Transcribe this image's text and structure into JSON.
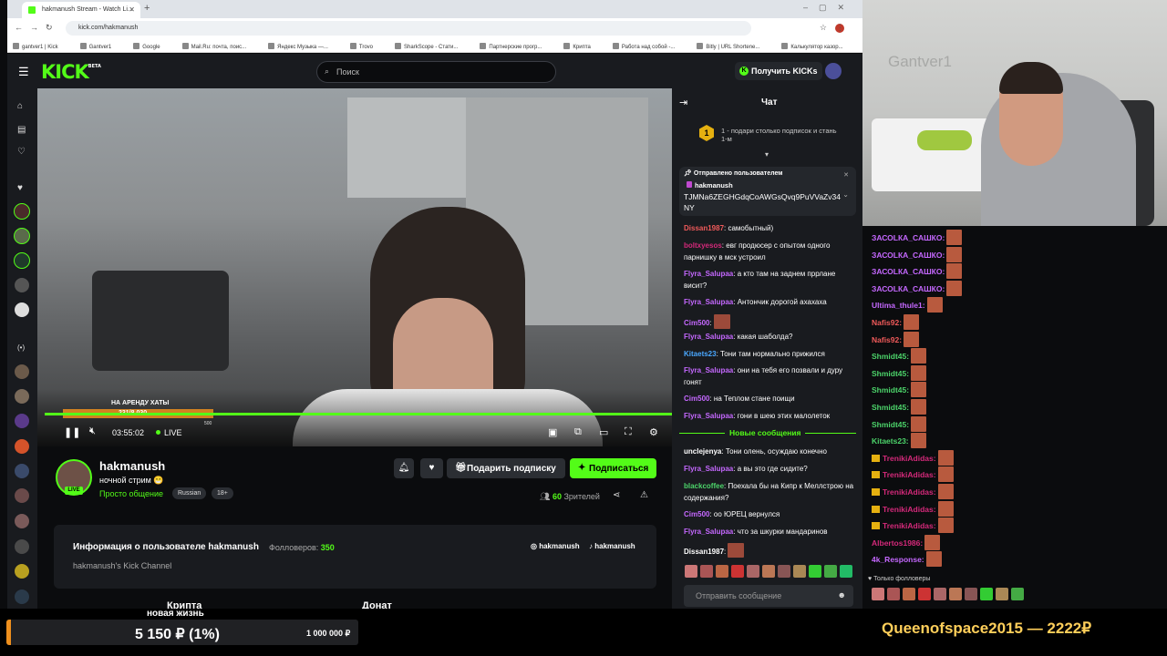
{
  "browser": {
    "tab_title": "hakmanush Stream - Watch Li...",
    "url": "kick.com/hakmanush",
    "bookmarks": [
      "gantver1 | Kick",
      "Gantver1",
      "Google",
      "Mail.Ru: почта, поис...",
      "Яндекс Музыка —...",
      "Trovo",
      "SharkScope - Стати...",
      "Партнерские прогр...",
      "Крипта",
      "Работа над собой -...",
      "Bitly | URL Shortene...",
      "Калькулятор казор...",
      "Портал государств...",
      "Все закладки"
    ]
  },
  "header": {
    "logo": "KICK",
    "logo_sup": "BETA",
    "search_placeholder": "Поиск",
    "get_kicks": "Получить KICKs"
  },
  "video": {
    "goal_label": "НА АРЕНДУ ХАТЫ",
    "goal_amount": "231/8 030",
    "goal_max": "500",
    "goal_progress": 0.24,
    "time": "03:55:02",
    "live": "LIVE"
  },
  "channel": {
    "name": "hakmanush",
    "live_badge": "LIVE",
    "stream_title": "ночной стрим 😁",
    "category": "Просто общение",
    "tags": [
      "Russian",
      "18+"
    ],
    "gift_button": "Подарить подписку",
    "subscribe_button": "Подписаться",
    "viewers_count": "60",
    "viewers_label": "Зрителей"
  },
  "about": {
    "title": "Информация о пользователе hakmanush",
    "followers_label": "Фолловеров:",
    "followers_count": "350",
    "description": "hakmanush's Kick Channel",
    "social1": "hakmanush",
    "social2": "hakmanush",
    "panel_a": "Крипта",
    "panel_b": "Донат"
  },
  "chat": {
    "title": "Чат",
    "promo_number": "1",
    "promo_text": "1 - подари столько подписок и стань 1-м",
    "pinned_header": "Отправлено пользователем",
    "pinned_user": "hakmanush",
    "pinned_message": "TJMNa6ZEGHGdqCoAWGsQvq9PuVVaZv34NY",
    "messages": [
      {
        "user": "Dissan1987",
        "color": "#f05a5a",
        "text": "самобытный)"
      },
      {
        "user": "boltxyesos",
        "color": "#d4297a",
        "text": "евг продюсер с опытом одного парнишку в мск устроил"
      },
      {
        "user": "Flyra_Salupaa",
        "color": "#c568ff",
        "text": "а кто там на заднем пррлане висит?"
      },
      {
        "user": "Flyra_Salupaa",
        "color": "#c568ff",
        "text": "Антончик дорогой ахахаха"
      },
      {
        "user": "Cim500",
        "color": "#c568ff",
        "text": ""
      },
      {
        "user": "Flyra_Salupaa",
        "color": "#c568ff",
        "text": "какая шаболда?"
      },
      {
        "user": "Kitaets23",
        "color": "#4aa8ff",
        "text": "Тони там нормально прижился"
      },
      {
        "user": "Flyra_Salupaa",
        "color": "#c568ff",
        "text": "они на тебя его позвали и дуру гонят"
      },
      {
        "user": "Cim500",
        "color": "#c568ff",
        "text": "на Теплом стане поищи"
      },
      {
        "user": "Flyra_Salupaa",
        "color": "#c568ff",
        "text": "гони в шею этих малолеток"
      }
    ],
    "new_messages": "Новые сообщения",
    "messages2": [
      {
        "user": "unclejenya",
        "color": "#ffffff",
        "text": "Тони олень, осуждаю конечно"
      },
      {
        "user": "Flyra_Salupaa",
        "color": "#c568ff",
        "text": "а вы это где сидите?"
      },
      {
        "user": "blackcoffee",
        "color": "#4cd46a",
        "text": "Поехала бы на Кипр к Меллстрою на содержания?"
      },
      {
        "user": "Cim500",
        "color": "#c568ff",
        "text": "оо ЮРЕЦ вернулся"
      },
      {
        "user": "Flyra_Salupaa",
        "color": "#c568ff",
        "text": "что за шкурки мандаринов"
      },
      {
        "user": "Dissan1987",
        "color": "#ffffff",
        "text": ""
      }
    ],
    "input_placeholder": "Отправить сообщение"
  },
  "webcam": {
    "watermark": "Gantver1"
  },
  "overlay_chat": {
    "messages": [
      {
        "user": "ЗАСОLКА_САШКО:",
        "color": "#c568ff",
        "crown": false
      },
      {
        "user": "ЗАСОLКА_САШКО:",
        "color": "#c568ff",
        "crown": false
      },
      {
        "user": "ЗАСОLКА_САШКО:",
        "color": "#c568ff",
        "crown": false
      },
      {
        "user": "ЗАСОLКА_САШКО:",
        "color": "#c568ff",
        "crown": false
      },
      {
        "user": "Ultima_thule1:",
        "color": "#c568ff",
        "crown": false
      },
      {
        "user": "Nafis92:",
        "color": "#f05a5a",
        "crown": false
      },
      {
        "user": "Nafis92:",
        "color": "#f05a5a",
        "crown": false
      },
      {
        "user": "Shmidt45:",
        "color": "#4cd46a",
        "crown": false
      },
      {
        "user": "Shmidt45:",
        "color": "#4cd46a",
        "crown": false
      },
      {
        "user": "Shmidt45:",
        "color": "#4cd46a",
        "crown": false
      },
      {
        "user": "Shmidt45:",
        "color": "#4cd46a",
        "crown": false
      },
      {
        "user": "Shmidt45:",
        "color": "#4cd46a",
        "crown": false
      },
      {
        "user": "Kitaets23:",
        "color": "#4cd46a",
        "crown": false
      },
      {
        "user": "TrenikiAdidas:",
        "color": "#d4297a",
        "crown": true
      },
      {
        "user": "TrenikiAdidas:",
        "color": "#d4297a",
        "crown": true
      },
      {
        "user": "TrenikiAdidas:",
        "color": "#d4297a",
        "crown": true
      },
      {
        "user": "TrenikiAdidas:",
        "color": "#d4297a",
        "crown": true
      },
      {
        "user": "TrenikiAdidas:",
        "color": "#d4297a",
        "crown": true
      },
      {
        "user": "Albertos1986:",
        "color": "#d4297a",
        "crown": false
      },
      {
        "user": "4k_Response:",
        "color": "#c568ff",
        "crown": false
      }
    ],
    "followers_only": "Только фолловеры"
  },
  "donation": {
    "title": "новая жизнь",
    "value": "5 150 ₽ (1%)",
    "max": "1 000 000 ₽",
    "progress": 0.01,
    "top_donor": "Queenofspace2015 — 2222₽"
  },
  "colors": {
    "accent": "#53fc18",
    "bg": "#0b0c0e",
    "panel": "#191b1f",
    "gold": "#ffcf5a"
  }
}
